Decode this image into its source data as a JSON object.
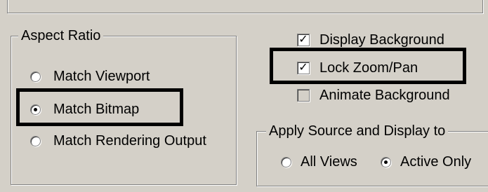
{
  "aspect_ratio": {
    "title": "Aspect Ratio",
    "options": [
      {
        "label": "Match Viewport",
        "checked": false
      },
      {
        "label": "Match Bitmap",
        "checked": true
      },
      {
        "label": "Match Rendering Output",
        "checked": false
      }
    ]
  },
  "background_options": [
    {
      "label": "Display Background",
      "checked": true
    },
    {
      "label": "Lock Zoom/Pan",
      "checked": true
    },
    {
      "label": "Animate Background",
      "checked": false
    }
  ],
  "apply_source": {
    "title": "Apply Source and Display to",
    "options": [
      {
        "label": "All Views",
        "checked": false
      },
      {
        "label": "Active Only",
        "checked": true
      }
    ]
  },
  "check_glyph": "✓",
  "colors": {
    "highlight": "#000000",
    "panel": "#d4d0c8"
  }
}
